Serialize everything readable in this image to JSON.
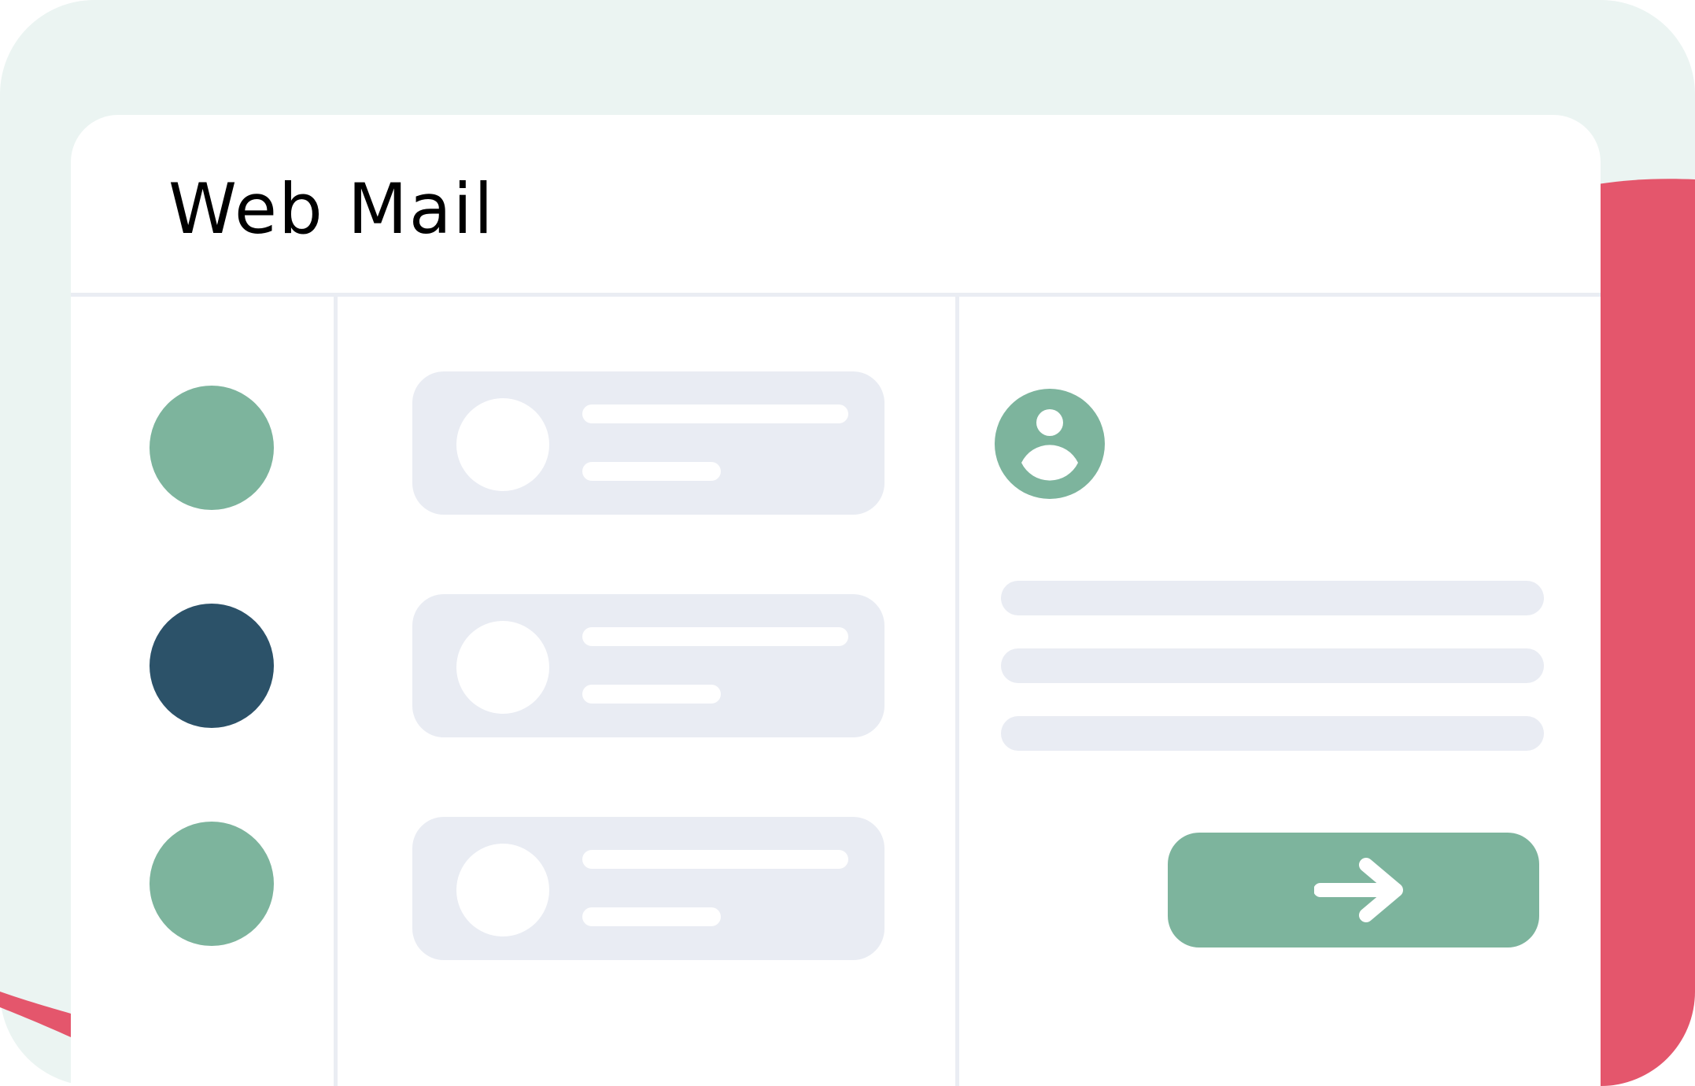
{
  "app": {
    "title": "Web Mail"
  },
  "colors": {
    "accent_green": "#7db49d",
    "dark_navy": "#2c5269",
    "accent_red": "#e4566c",
    "background_mint": "#ebf4f2",
    "placeholder_gray": "#e9ecf3",
    "divider": "#eaedf3"
  },
  "folders": [
    {
      "icon": "circle",
      "color": "#7db49d",
      "selected": false
    },
    {
      "icon": "circle",
      "color": "#2c5269",
      "selected": true
    },
    {
      "icon": "circle",
      "color": "#7db49d",
      "selected": false
    }
  ],
  "messages": [
    {
      "avatar": "placeholder-circle",
      "lines": [
        "long",
        "short"
      ]
    },
    {
      "avatar": "placeholder-circle",
      "lines": [
        "long",
        "short"
      ]
    },
    {
      "avatar": "placeholder-circle",
      "lines": [
        "long",
        "short"
      ]
    }
  ],
  "reading_pane": {
    "contact_icon": "user-icon",
    "content_lines": 3,
    "action_button_icon": "arrow-right-icon"
  }
}
